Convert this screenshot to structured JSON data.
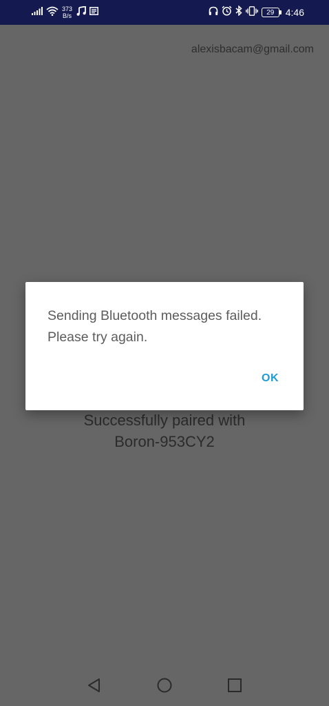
{
  "status_bar": {
    "net_speed_value": "373",
    "net_speed_unit": "B/s",
    "battery_level": "29",
    "time": "4:46"
  },
  "app": {
    "account_email": "alexisbacam@gmail.com",
    "paired_line1": "Successfully paired with",
    "paired_line2": "Boron-953CY2"
  },
  "dialog": {
    "message_line1": "Sending Bluetooth messages failed.",
    "message_line2": "Please try again.",
    "ok_label": "OK"
  },
  "nav": {
    "icons": [
      "back-icon",
      "home-icon",
      "recents-icon"
    ]
  }
}
